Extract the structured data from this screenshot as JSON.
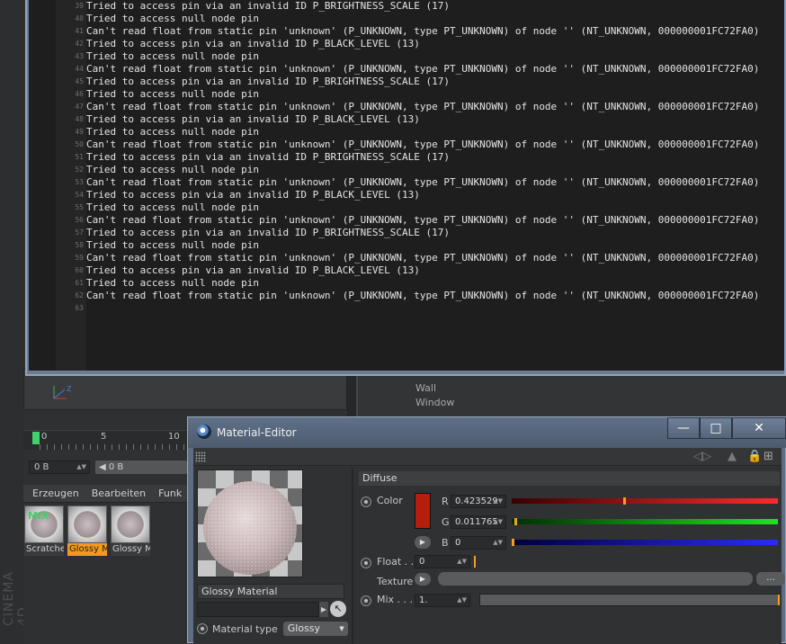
{
  "console": {
    "lines": [
      {
        "n": "39",
        "t": "Tried to access pin via an invalid ID P_BRIGHTNESS_SCALE (17)"
      },
      {
        "n": "40",
        "t": "Tried to access null node pin"
      },
      {
        "n": "41",
        "t": "Can't read float from static pin 'unknown' (P_UNKNOWN, type PT_UNKNOWN) of node '' (NT_UNKNOWN, 000000001FC72FA0)"
      },
      {
        "n": "42",
        "t": "Tried to access pin via an invalid ID P_BLACK_LEVEL (13)"
      },
      {
        "n": "43",
        "t": "Tried to access null node pin"
      },
      {
        "n": "44",
        "t": "Can't read float from static pin 'unknown' (P_UNKNOWN, type PT_UNKNOWN) of node '' (NT_UNKNOWN, 000000001FC72FA0)"
      },
      {
        "n": "45",
        "t": "Tried to access pin via an invalid ID P_BRIGHTNESS_SCALE (17)"
      },
      {
        "n": "46",
        "t": "Tried to access null node pin"
      },
      {
        "n": "47",
        "t": "Can't read float from static pin 'unknown' (P_UNKNOWN, type PT_UNKNOWN) of node '' (NT_UNKNOWN, 000000001FC72FA0)"
      },
      {
        "n": "48",
        "t": "Tried to access pin via an invalid ID P_BLACK_LEVEL (13)"
      },
      {
        "n": "49",
        "t": "Tried to access null node pin"
      },
      {
        "n": "50",
        "t": "Can't read float from static pin 'unknown' (P_UNKNOWN, type PT_UNKNOWN) of node '' (NT_UNKNOWN, 000000001FC72FA0)"
      },
      {
        "n": "51",
        "t": "Tried to access pin via an invalid ID P_BRIGHTNESS_SCALE (17)"
      },
      {
        "n": "52",
        "t": "Tried to access null node pin"
      },
      {
        "n": "53",
        "t": "Can't read float from static pin 'unknown' (P_UNKNOWN, type PT_UNKNOWN) of node '' (NT_UNKNOWN, 000000001FC72FA0)"
      },
      {
        "n": "54",
        "t": "Tried to access pin via an invalid ID P_BLACK_LEVEL (13)"
      },
      {
        "n": "55",
        "t": "Tried to access null node pin"
      },
      {
        "n": "56",
        "t": "Can't read float from static pin 'unknown' (P_UNKNOWN, type PT_UNKNOWN) of node '' (NT_UNKNOWN, 000000001FC72FA0)"
      },
      {
        "n": "57",
        "t": "Tried to access pin via an invalid ID P_BRIGHTNESS_SCALE (17)"
      },
      {
        "n": "58",
        "t": "Tried to access null node pin"
      },
      {
        "n": "59",
        "t": "Can't read float from static pin 'unknown' (P_UNKNOWN, type PT_UNKNOWN) of node '' (NT_UNKNOWN, 000000001FC72FA0)"
      },
      {
        "n": "60",
        "t": "Tried to access pin via an invalid ID P_BLACK_LEVEL (13)"
      },
      {
        "n": "61",
        "t": "Tried to access null node pin"
      },
      {
        "n": "62",
        "t": "Can't read float from static pin 'unknown' (P_UNKNOWN, type PT_UNKNOWN) of node '' (NT_UNKNOWN, 000000001FC72FA0)"
      },
      {
        "n": "63",
        "t": ""
      }
    ]
  },
  "background": {
    "app_logo": "CINEMA 4D",
    "objects": [
      "Wall",
      "Window"
    ],
    "timeline": {
      "ticks": [
        "0",
        "5",
        "10"
      ]
    },
    "frame_fields": [
      "0 B",
      "◀ 0 B"
    ]
  },
  "material_manager": {
    "menu": [
      "Erzeugen",
      "Bearbeiten",
      "Funk"
    ],
    "thumb_overlay": "MIX",
    "materials": [
      {
        "label": "Scratche",
        "selected": false
      },
      {
        "label": "Glossy M",
        "selected": true
      },
      {
        "label": "Glossy M",
        "selected": false
      }
    ]
  },
  "material_editor": {
    "title": "Material-Editor",
    "window_buttons": {
      "minimize": "—",
      "maximize": "□",
      "close": "✕"
    },
    "material_name": "Glossy Material",
    "material_type_label": "Material type",
    "material_type_value": "Glossy",
    "section": "Diffuse",
    "color": {
      "label": "Color",
      "swatch": "#b41e0b",
      "r_label": "R",
      "r_value": "0.423529",
      "r_level": 0.4235,
      "g_label": "G",
      "g_value": "0.011765",
      "g_level": 0.0118,
      "b_label": "B",
      "b_value": "0"
    },
    "float": {
      "label": "Float . .",
      "value": "0"
    },
    "texture": {
      "label": "Texture",
      "button": "..."
    },
    "mix": {
      "label": "Mix . . .",
      "value": "1.",
      "level": 1.0
    }
  }
}
